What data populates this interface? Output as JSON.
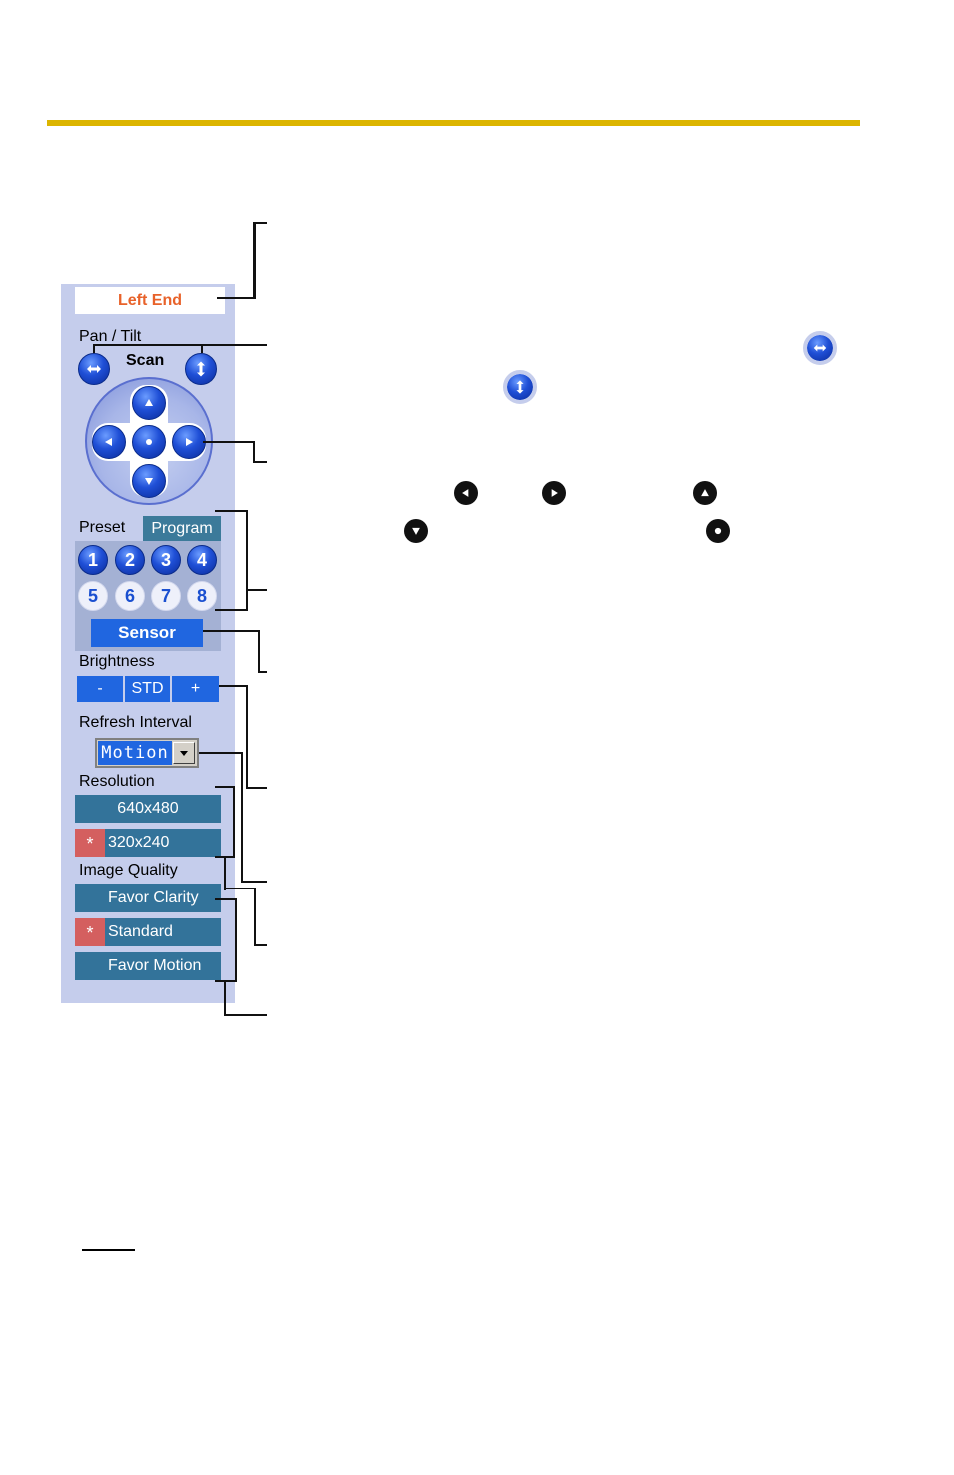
{
  "panel": {
    "status_text": "Left End",
    "pan_tilt_label": "Pan / Tilt",
    "scan_label": "Scan",
    "icons": {
      "pan_scan": "horizontal-arrows-icon",
      "tilt_scan": "vertical-arrows-icon",
      "up": "arrow-up-icon",
      "down": "arrow-down-icon",
      "left": "arrow-left-icon",
      "right": "arrow-right-icon",
      "home": "center-home-icon"
    },
    "preset": {
      "label": "Preset",
      "program_tab": "Program",
      "buttons_registered": [
        "1",
        "2",
        "3",
        "4"
      ],
      "buttons_unregistered": [
        "5",
        "6",
        "7",
        "8"
      ],
      "sensor_label": "Sensor"
    },
    "brightness": {
      "label": "Brightness",
      "minus": "-",
      "standard": "STD",
      "plus": "+"
    },
    "refresh_interval": {
      "label": "Refresh Interval",
      "selected": "Motion"
    },
    "resolution": {
      "label": "Resolution",
      "options": [
        {
          "label": "640x480",
          "selected": false
        },
        {
          "label": "320x240",
          "selected": true
        }
      ]
    },
    "image_quality": {
      "label": "Image Quality",
      "options": [
        {
          "label": "Favor Clarity",
          "selected": false
        },
        {
          "label": "Standard",
          "selected": true
        },
        {
          "label": "Favor Motion",
          "selected": false
        }
      ]
    },
    "selected_marker": "*"
  },
  "colors": {
    "accent_rule": "#dcb500",
    "panel_bg": "#c5cdec",
    "status_text": "#e8622a",
    "button_blue": "#2066e0",
    "button_teal": "#33739a",
    "selected_marker_bg": "#d45f5f"
  }
}
